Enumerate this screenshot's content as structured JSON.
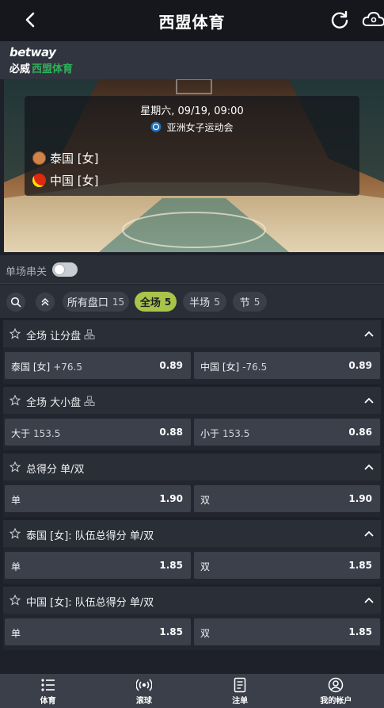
{
  "header": {
    "title": "西盟体育"
  },
  "brand": {
    "line1": "betway",
    "line2a": "必威",
    "line2b": "西盟体育"
  },
  "event": {
    "datetime": "星期六, 09/19, 09:00",
    "league": "亚洲女子运动会",
    "home": "泰国 [女]",
    "away": "中国 [女]"
  },
  "parlay": {
    "label": "单场串关",
    "on": false
  },
  "filters": [
    {
      "label": "所有盘口",
      "count": "15"
    },
    {
      "label": "全场",
      "count": "5"
    },
    {
      "label": "半场",
      "count": "5"
    },
    {
      "label": "节",
      "count": "5"
    }
  ],
  "markets": [
    {
      "title": "全场 让分盘",
      "sgp": true,
      "odds": [
        {
          "sel": "泰国 [女]",
          "line": "+76.5",
          "price": "0.89"
        },
        {
          "sel": "中国 [女]",
          "line": "-76.5",
          "price": "0.89"
        }
      ]
    },
    {
      "title": "全场 大小盘",
      "sgp": true,
      "odds": [
        {
          "sel": "大于",
          "line": "153.5",
          "price": "0.88"
        },
        {
          "sel": "小于",
          "line": "153.5",
          "price": "0.86"
        }
      ]
    },
    {
      "title": "总得分 单/双",
      "sgp": false,
      "odds": [
        {
          "sel": "单",
          "line": "",
          "price": "1.90"
        },
        {
          "sel": "双",
          "line": "",
          "price": "1.90"
        }
      ]
    },
    {
      "title": "泰国 [女]: 队伍总得分 单/双",
      "sgp": false,
      "odds": [
        {
          "sel": "单",
          "line": "",
          "price": "1.85"
        },
        {
          "sel": "双",
          "line": "",
          "price": "1.85"
        }
      ]
    },
    {
      "title": "中国 [女]: 队伍总得分 单/双",
      "sgp": false,
      "odds": [
        {
          "sel": "单",
          "line": "",
          "price": "1.85"
        },
        {
          "sel": "双",
          "line": "",
          "price": "1.85"
        }
      ]
    }
  ],
  "bottom_nav": [
    {
      "label": "体育",
      "icon": "sports-list-icon"
    },
    {
      "label": "滚球",
      "icon": "live-broadcast-icon"
    },
    {
      "label": "注单",
      "icon": "bet-slip-icon"
    },
    {
      "label": "我的帐户",
      "icon": "account-icon"
    }
  ],
  "colors": {
    "accent": "#a8c44a",
    "header_bg": "#15171c",
    "panel": "#2a2e37",
    "odd_bg": "#3b404b",
    "brand_green": "#2fb15a"
  }
}
